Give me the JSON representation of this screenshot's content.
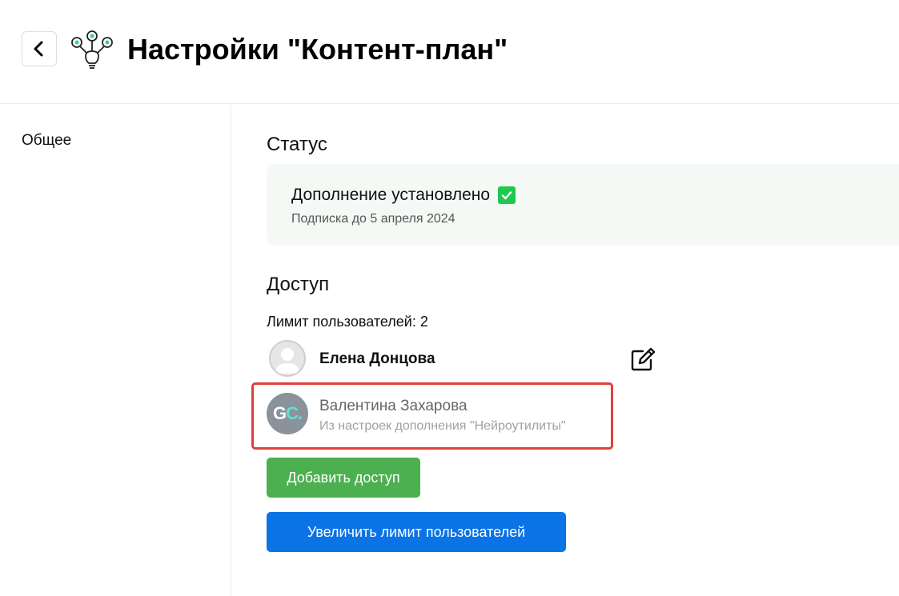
{
  "header": {
    "title": "Настройки \"Контент-план\"",
    "back_icon": "chevron-left-icon",
    "logo_icon": "app-logo-icon"
  },
  "sidebar": {
    "items": [
      {
        "label": "Общее"
      }
    ]
  },
  "status": {
    "title": "Статус",
    "installed_text": "Дополнение установлено",
    "subscription_text": "Подписка до 5 апреля 2024",
    "check_icon": "check-icon",
    "accent_color": "#1ec94f"
  },
  "access": {
    "title": "Доступ",
    "user_limit_text": "Лимит пользователей: 2",
    "users": [
      {
        "name": "Елена Донцова",
        "source": "",
        "avatar": "default-avatar-icon"
      },
      {
        "name": "Валентина Захарова",
        "source": "Из настроек дополнения \"Нейроутилиты\"",
        "avatar_initials_1": "G",
        "avatar_initials_2": "C."
      }
    ],
    "edit_icon": "edit-icon",
    "highlight_color": "#e0403a"
  },
  "buttons": {
    "add_access": "Добавить доступ",
    "increase_limit": "Увеличить лимит пользователей",
    "add_color": "#4caf50",
    "limit_color": "#0a73e6"
  }
}
